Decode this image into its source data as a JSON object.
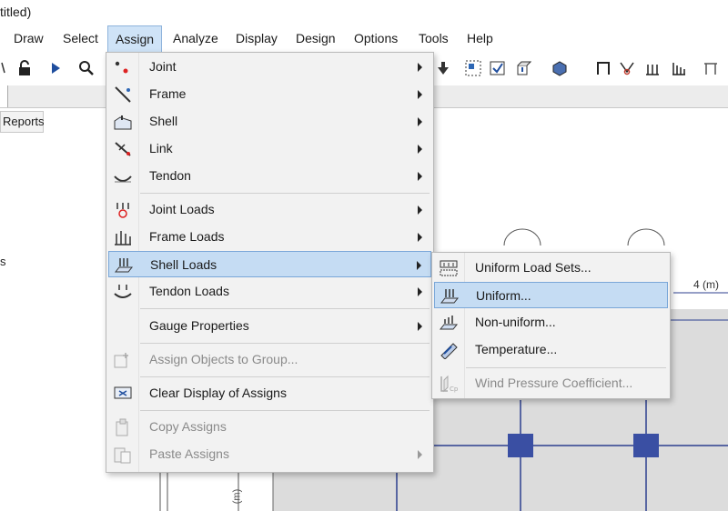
{
  "window": {
    "title": "titled)"
  },
  "menubar": {
    "items": [
      "Draw",
      "Select",
      "Assign",
      "Analyze",
      "Display",
      "Design",
      "Options",
      "Tools",
      "Help"
    ]
  },
  "tabs": {
    "reports": "Reports"
  },
  "left_panel": {
    "fragment": "s"
  },
  "canvas": {
    "grid_label": "4 (m)",
    "vertical_fragment": "(m)"
  },
  "assign_menu": {
    "items": [
      {
        "label": "Joint",
        "icon": "joint-icon",
        "submenu": true,
        "enabled": true
      },
      {
        "label": "Frame",
        "icon": "frame-icon",
        "submenu": true,
        "enabled": true
      },
      {
        "label": "Shell",
        "icon": "shell-icon",
        "submenu": true,
        "enabled": true
      },
      {
        "label": "Link",
        "icon": "link-icon",
        "submenu": true,
        "enabled": true
      },
      {
        "label": "Tendon",
        "icon": "tendon-icon",
        "submenu": true,
        "enabled": true
      },
      {
        "label": "Joint Loads",
        "icon": "joint-loads-icon",
        "submenu": true,
        "enabled": true
      },
      {
        "label": "Frame Loads",
        "icon": "frame-loads-icon",
        "submenu": true,
        "enabled": true
      },
      {
        "label": "Shell Loads",
        "icon": "shell-loads-icon",
        "submenu": true,
        "enabled": true,
        "highlighted": true
      },
      {
        "label": "Tendon Loads",
        "icon": "tendon-loads-icon",
        "submenu": true,
        "enabled": true
      },
      {
        "label": "Gauge Properties",
        "icon": "",
        "submenu": true,
        "enabled": true
      },
      {
        "label": "Assign Objects to Group...",
        "icon": "group-icon",
        "submenu": false,
        "enabled": false
      },
      {
        "label": "Clear Display of Assigns",
        "icon": "clear-display-icon",
        "submenu": false,
        "enabled": true
      },
      {
        "label": "Copy Assigns",
        "icon": "copy-icon",
        "submenu": false,
        "enabled": false
      },
      {
        "label": "Paste Assigns",
        "icon": "paste-icon",
        "submenu": true,
        "enabled": false
      }
    ]
  },
  "shell_loads_menu": {
    "items": [
      {
        "label": "Uniform Load Sets...",
        "icon": "uniform-load-sets-icon",
        "enabled": true
      },
      {
        "label": "Uniform...",
        "icon": "uniform-icon",
        "enabled": true,
        "highlighted": true
      },
      {
        "label": "Non-uniform...",
        "icon": "non-uniform-icon",
        "enabled": true
      },
      {
        "label": "Temperature...",
        "icon": "temperature-icon",
        "enabled": true
      },
      {
        "label": "Wind Pressure Coefficient...",
        "icon": "wind-pressure-icon",
        "enabled": false
      }
    ]
  },
  "colors": {
    "highlight": "#c5dcf3",
    "highlight_border": "#7aa7d8",
    "grid": "#2c3f8f",
    "column": "#3a4fa3",
    "canvas": "#dcdcdc"
  }
}
